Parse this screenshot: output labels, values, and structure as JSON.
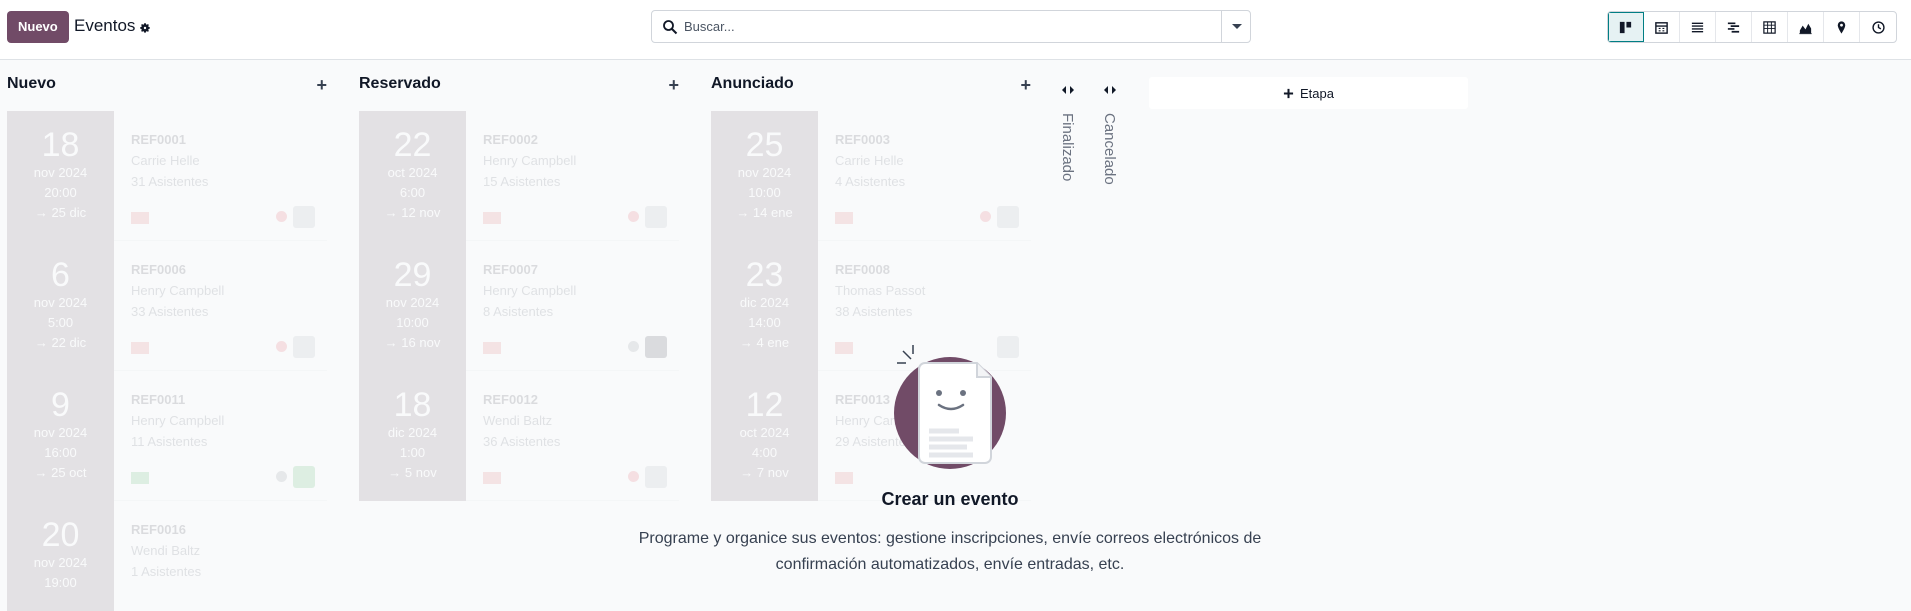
{
  "header": {
    "new_button": "Nuevo",
    "title": "Eventos",
    "search_placeholder": "Buscar..."
  },
  "view_switcher": [
    "kanban-view-icon",
    "calendar-view-icon",
    "list-view-icon",
    "gantt-view-icon",
    "pivot-view-icon",
    "graph-view-icon",
    "map-view-icon",
    "activity-view-icon"
  ],
  "columns": [
    {
      "title": "Nuevo",
      "cards": [
        {
          "day": "18",
          "month": "nov 2024",
          "time": "20:00",
          "end": "→ 25 dic",
          "ref": "REF0001",
          "place": "Carrie Helle",
          "attendees": "31 Asistentes"
        },
        {
          "day": "6",
          "month": "nov 2024",
          "time": "5:00",
          "end": "→ 22 dic",
          "ref": "REF0006",
          "place": "Henry Campbell",
          "attendees": "33 Asistentes"
        },
        {
          "day": "9",
          "month": "nov 2024",
          "time": "16:00",
          "end": "→ 25 oct",
          "ref": "REF0011",
          "place": "Henry Campbell",
          "attendees": "11 Asistentes"
        },
        {
          "day": "20",
          "month": "nov 2024",
          "time": "19:00",
          "end": "",
          "ref": "REF0016",
          "place": "Wendi Baltz",
          "attendees": "1 Asistentes"
        }
      ]
    },
    {
      "title": "Reservado",
      "cards": [
        {
          "day": "22",
          "month": "oct 2024",
          "time": "6:00",
          "end": "→ 12 nov",
          "ref": "REF0002",
          "place": "Henry Campbell",
          "attendees": "15 Asistentes"
        },
        {
          "day": "29",
          "month": "nov 2024",
          "time": "10:00",
          "end": "→ 16 nov",
          "ref": "REF0007",
          "place": "Henry Campbell",
          "attendees": "8 Asistentes"
        },
        {
          "day": "18",
          "month": "dic 2024",
          "time": "1:00",
          "end": "→ 5 nov",
          "ref": "REF0012",
          "place": "Wendi Baltz",
          "attendees": "36 Asistentes"
        }
      ]
    },
    {
      "title": "Anunciado",
      "cards": [
        {
          "day": "25",
          "month": "nov 2024",
          "time": "10:00",
          "end": "→ 14 ene",
          "ref": "REF0003",
          "place": "Carrie Helle",
          "attendees": "4 Asistentes"
        },
        {
          "day": "23",
          "month": "dic 2024",
          "time": "14:00",
          "end": "→ 4 ene",
          "ref": "REF0008",
          "place": "Thomas Passot",
          "attendees": "38 Asistentes"
        },
        {
          "day": "12",
          "month": "oct 2024",
          "time": "4:00",
          "end": "→ 7 nov",
          "ref": "REF0013",
          "place": "Henry Campbell",
          "attendees": "29 Asistentes"
        }
      ]
    }
  ],
  "folded_columns": [
    "Finalizado",
    "Cancelado"
  ],
  "add_stage_label": "Etapa",
  "help": {
    "title": "Crear un evento",
    "line1": "Programe y organice sus eventos: gestione inscripciones, envíe correos electrónicos de",
    "line2": "confirmación automatizados, envíe entradas, etc."
  },
  "colors": {
    "brand": "#714b67",
    "accent": "#017e84"
  }
}
